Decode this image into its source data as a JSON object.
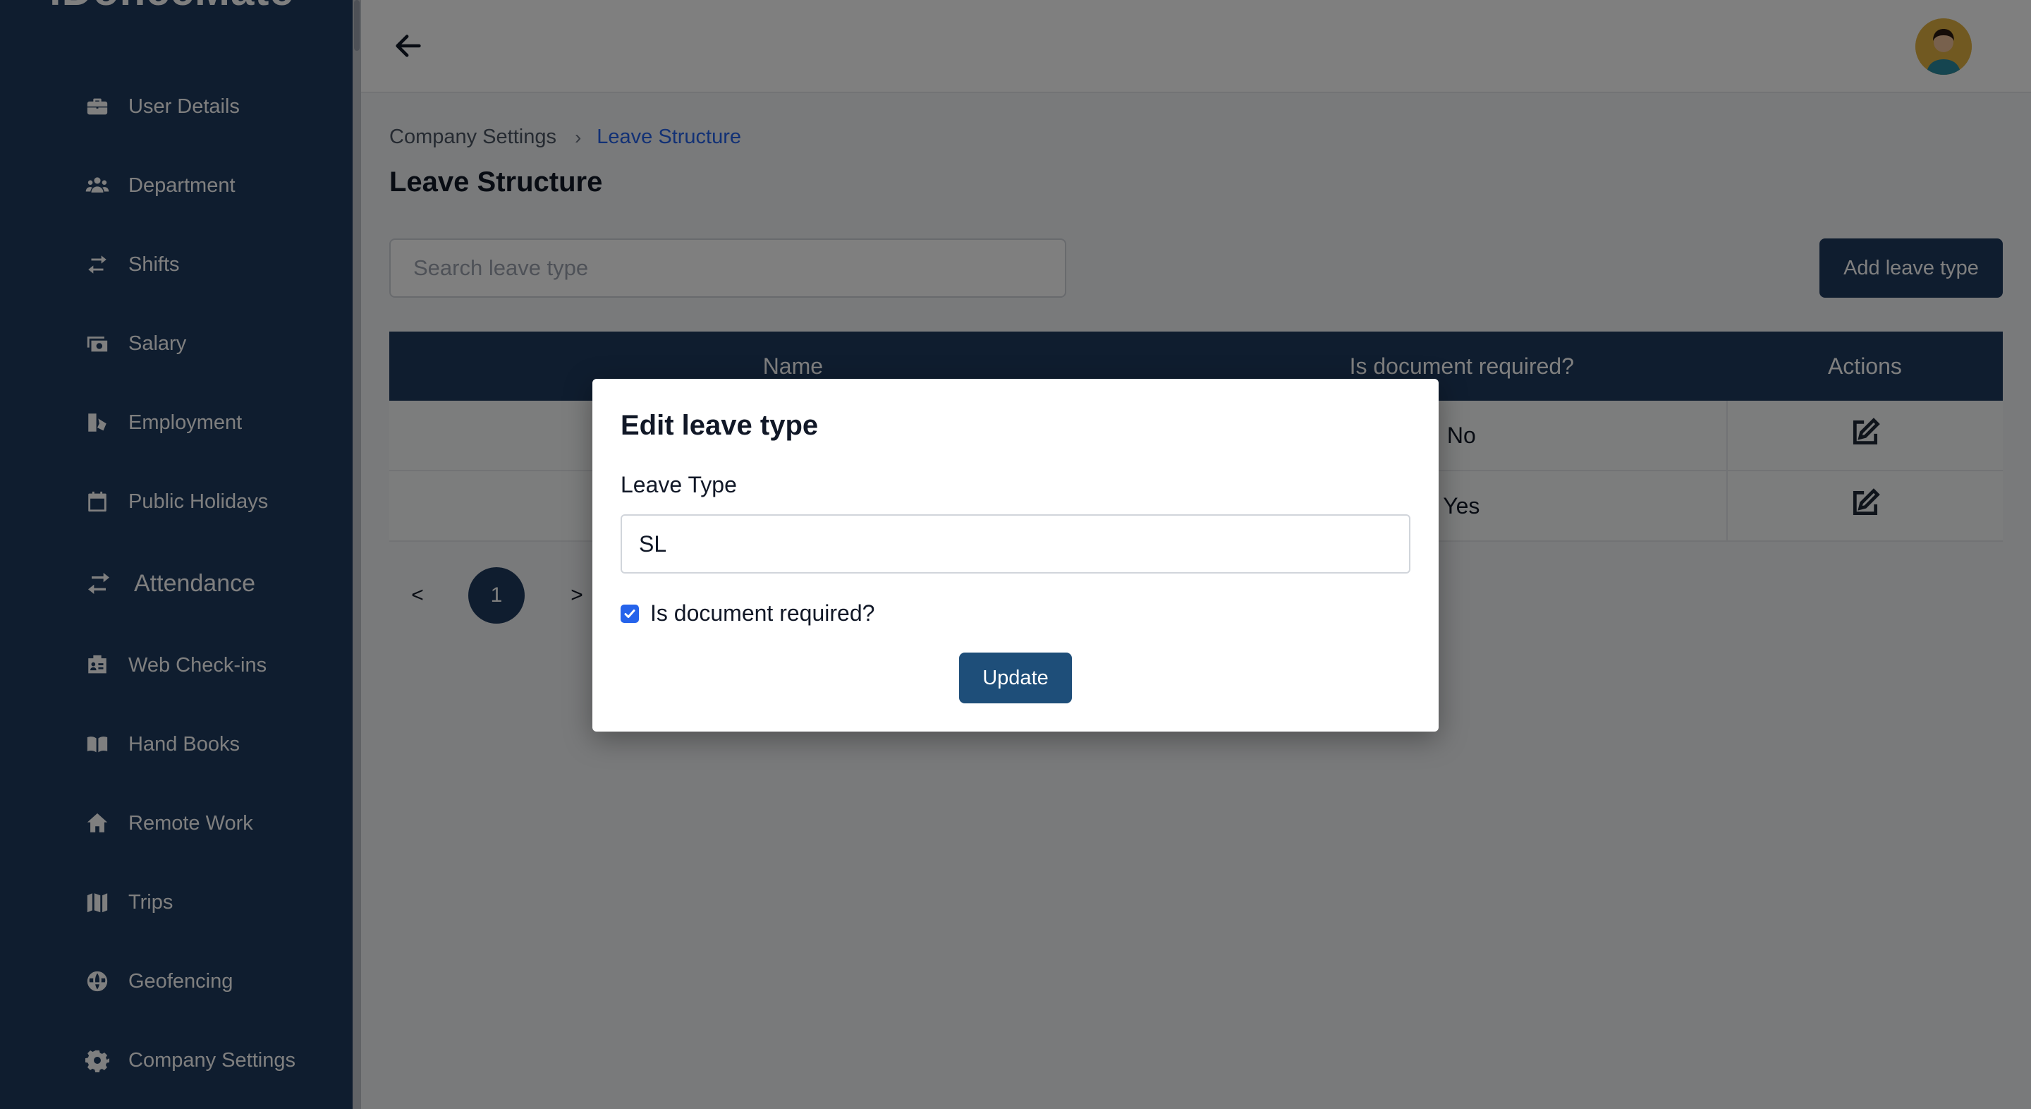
{
  "app": {
    "logo_text": "iDonceMate"
  },
  "sidebar": {
    "items": [
      {
        "label": "User Details",
        "icon": "briefcase-icon"
      },
      {
        "label": "Department",
        "icon": "users-icon"
      },
      {
        "label": "Shifts",
        "icon": "swap-arrows-icon"
      },
      {
        "label": "Salary",
        "icon": "money-icon"
      },
      {
        "label": "Employment",
        "icon": "employment-icon"
      },
      {
        "label": "Public Holidays",
        "icon": "calendar-icon"
      },
      {
        "label": "Attendance",
        "icon": "swap-arrows-icon"
      },
      {
        "label": "Web Check-ins",
        "icon": "id-card-icon"
      },
      {
        "label": "Hand Books",
        "icon": "book-icon"
      },
      {
        "label": "Remote Work",
        "icon": "home-icon"
      },
      {
        "label": "Trips",
        "icon": "map-icon"
      },
      {
        "label": "Geofencing",
        "icon": "globe-icon"
      },
      {
        "label": "Company Settings",
        "icon": "gear-icon"
      }
    ]
  },
  "header": {
    "back_icon": "arrow-left-icon",
    "avatar_icon": "user-avatar-icon"
  },
  "breadcrumb": {
    "parent": "Company Settings",
    "separator": "›",
    "current": "Leave Structure"
  },
  "page": {
    "title": "Leave Structure"
  },
  "search": {
    "placeholder": "Search leave type",
    "value": ""
  },
  "toolbar": {
    "add_label": "Add leave type"
  },
  "table": {
    "columns": [
      "Name",
      "Is document required?",
      "Actions"
    ],
    "rows": [
      {
        "name": "",
        "doc_required": "No",
        "action_icon": "edit-icon"
      },
      {
        "name": "",
        "doc_required": "Yes",
        "action_icon": "edit-icon"
      }
    ]
  },
  "pagination": {
    "prev": "<",
    "current": "1",
    "next": ">"
  },
  "modal": {
    "title": "Edit leave type",
    "field_label": "Leave Type",
    "field_value": "SL",
    "checkbox_label": "Is document required?",
    "checkbox_checked": true,
    "update_label": "Update"
  },
  "colors": {
    "primary": "#1e3a5f",
    "accent": "#2563eb",
    "modal_button": "#1e4e79"
  }
}
